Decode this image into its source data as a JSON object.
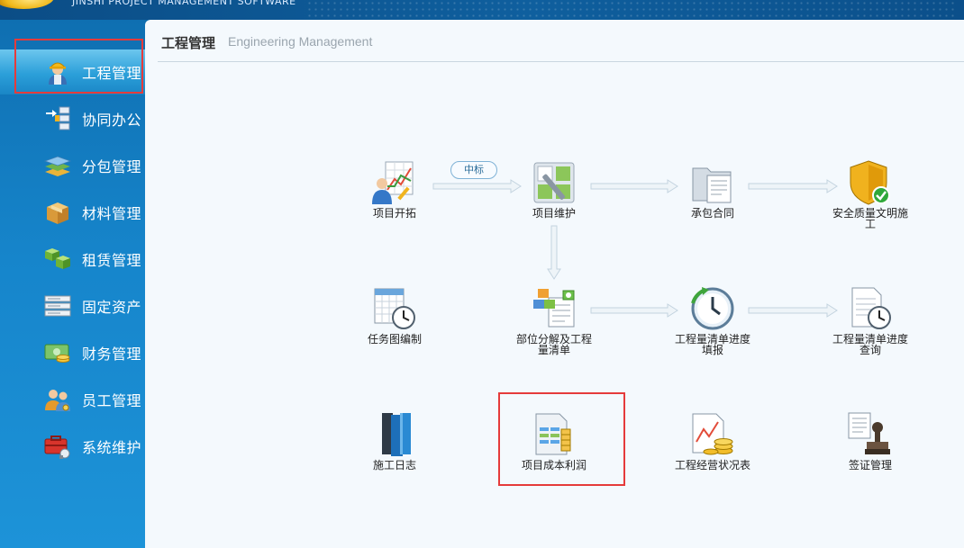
{
  "header": {
    "brand_text": "JINSHI PROJECT MANAGEMENT SOFTWARE"
  },
  "sidebar": {
    "items": [
      {
        "label": "工程管理",
        "icon": "worker-icon",
        "active": true
      },
      {
        "label": "协同办公",
        "icon": "workflow-icon",
        "active": false
      },
      {
        "label": "分包管理",
        "icon": "layers-icon",
        "active": false
      },
      {
        "label": "材料管理",
        "icon": "box-icon",
        "active": false
      },
      {
        "label": "租赁管理",
        "icon": "cubes-icon",
        "active": false
      },
      {
        "label": "固定资产",
        "icon": "server-icon",
        "active": false
      },
      {
        "label": "财务管理",
        "icon": "money-icon",
        "active": false
      },
      {
        "label": "员工管理",
        "icon": "people-icon",
        "active": false
      },
      {
        "label": "系统维护",
        "icon": "toolbox-icon",
        "active": false
      }
    ]
  },
  "main": {
    "title": "工程管理",
    "subtitle": "Engineering Management",
    "flow_badge": "中标",
    "nodes": [
      {
        "label": "项目开拓",
        "icon": "person-chart-icon"
      },
      {
        "label": "项目维护",
        "icon": "wrench-icon"
      },
      {
        "label": "承包合同",
        "icon": "folder-document-icon"
      },
      {
        "label": "安全质量文明施工",
        "icon": "shield-check-icon"
      },
      {
        "label": "任务图编制",
        "icon": "calendar-clock-icon"
      },
      {
        "label": "部位分解及工程量清单",
        "icon": "blocks-document-icon"
      },
      {
        "label": "工程量清单进度填报",
        "icon": "clock-arrow-icon"
      },
      {
        "label": "工程量清单进度查询",
        "icon": "document-clock-icon"
      },
      {
        "label": "施工日志",
        "icon": "books-icon"
      },
      {
        "label": "项目成本利润",
        "icon": "document-table-icon"
      },
      {
        "label": "工程经营状况表",
        "icon": "chart-coins-icon"
      },
      {
        "label": "签证管理",
        "icon": "stamp-icon"
      }
    ]
  },
  "colors": {
    "sidebar_blue": "#1685cb",
    "highlight_red": "#e53b3b",
    "panel_bg": "#f4f9fd"
  }
}
